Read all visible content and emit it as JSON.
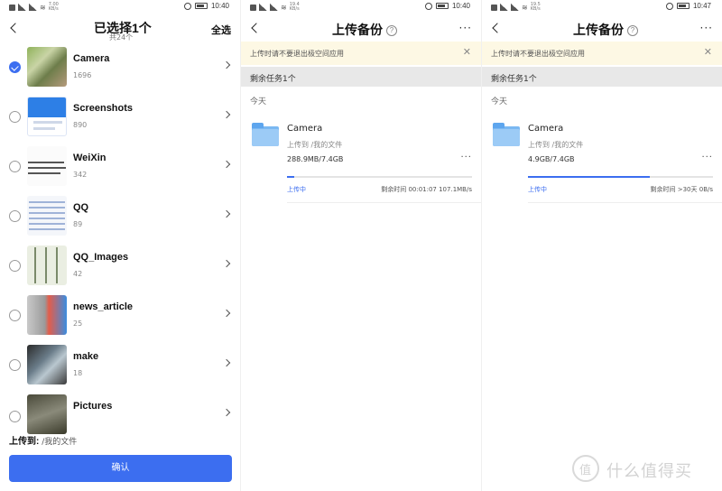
{
  "panel1": {
    "status": {
      "time": "10:40",
      "speed": "7.00 KB/s"
    },
    "title": "已选择1个",
    "subtitle": "共24个",
    "select_all": "全选",
    "folders": [
      {
        "name": "Camera",
        "count": "1696",
        "selected": true
      },
      {
        "name": "Screenshots",
        "count": "890",
        "selected": false
      },
      {
        "name": "WeiXin",
        "count": "342",
        "selected": false
      },
      {
        "name": "QQ",
        "count": "89",
        "selected": false
      },
      {
        "name": "QQ_Images",
        "count": "42",
        "selected": false
      },
      {
        "name": "news_article",
        "count": "25",
        "selected": false
      },
      {
        "name": "make",
        "count": "18",
        "selected": false
      },
      {
        "name": "Pictures",
        "count": "",
        "selected": false
      }
    ],
    "upload_to_label": "上传到:",
    "upload_to_path": "/我的文件",
    "confirm_label": "确认"
  },
  "panel2": {
    "status": {
      "time": "10:40",
      "speed": "19.4 KB/s"
    },
    "title": "上传备份",
    "warning": "上传时请不要退出极空间应用",
    "remaining": "剩余任务1个",
    "today": "今天",
    "task": {
      "name": "Camera",
      "dest": "上传到 /我的文件",
      "size": "288.9MB/7.4GB",
      "progress": 0.04,
      "state": "上传中",
      "eta": "剩余时间 00:01:07 107.1MB/s"
    }
  },
  "panel3": {
    "status": {
      "time": "10:47",
      "speed": "19.5 KB/s"
    },
    "title": "上传备份",
    "warning": "上传时请不要退出极空间应用",
    "remaining": "剩余任务1个",
    "today": "今天",
    "task": {
      "name": "Camera",
      "dest": "上传到 /我的文件",
      "size": "4.9GB/7.4GB",
      "progress": 0.66,
      "state": "上传中",
      "eta": "剩余时间 >30天 0B/s"
    }
  },
  "watermark": {
    "text": "什么值得买"
  },
  "colors": {
    "accent": "#3c6ef0",
    "warning_bg": "#fdf8e4",
    "section_bg": "#e8e8e8"
  }
}
